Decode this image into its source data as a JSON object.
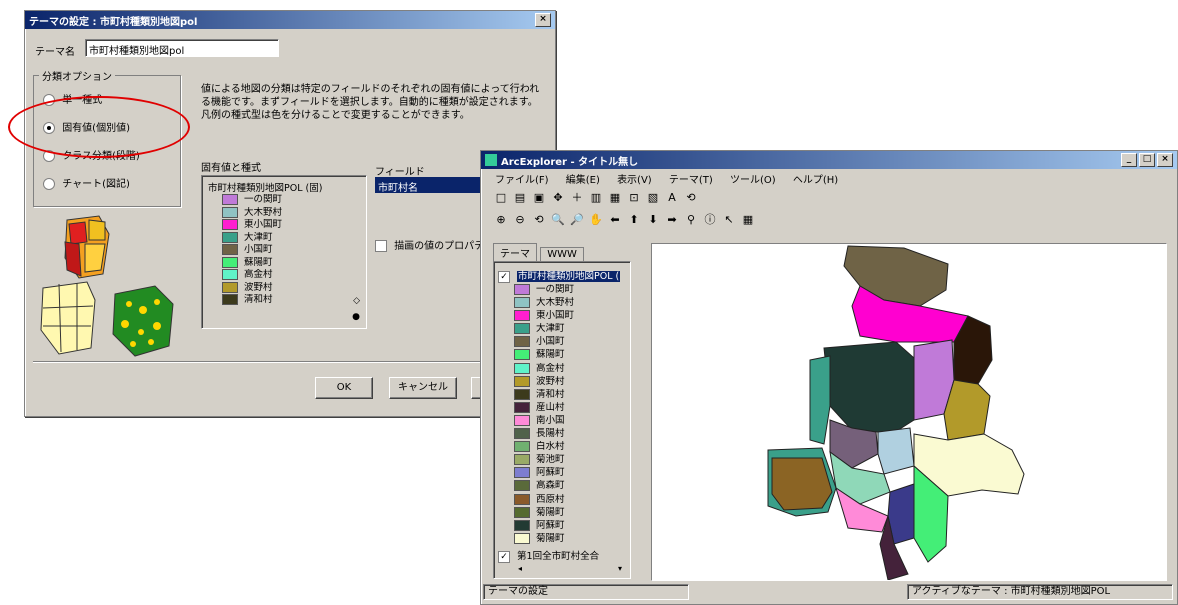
{
  "dialog": {
    "title": "テーマの設定 : 市町村種類別地図pol",
    "close": "×",
    "theme_name_label": "テーマ名",
    "theme_name_value": "市町村種類別地図pol",
    "group_title": "分類オプション",
    "options": [
      {
        "label": "単一種式",
        "selected": false
      },
      {
        "label": "固有値(個別値)",
        "selected": true
      },
      {
        "label": "クラス分類(段階)",
        "selected": false
      },
      {
        "label": "チャート(図記)",
        "selected": false
      }
    ],
    "description": "値による地図の分類は特定のフィールドのそれぞれの固有値によって行われる機能です。まずフィールドを選択します。自動的に種類が設定されます。凡例の種式型は色を分けることで変更することができます。",
    "values_title": "固有値と種式",
    "legend_header": "市町村種類別地図POL (固)",
    "legend_items": [
      {
        "label": "一の関町",
        "color": "#c07ad8"
      },
      {
        "label": "大木野村",
        "color": "#8fc3c3"
      },
      {
        "label": "東小国町",
        "color": "#ff1fcf"
      },
      {
        "label": "大津町",
        "color": "#3aa08a"
      },
      {
        "label": "小国町",
        "color": "#6f6346"
      },
      {
        "label": "蘇陽町",
        "color": "#44ee77"
      },
      {
        "label": "高金村",
        "color": "#5ff2c8"
      },
      {
        "label": "波野村",
        "color": "#b29a2a"
      },
      {
        "label": "清和村",
        "color": "#3c3a1c"
      }
    ],
    "field_label": "フィールド",
    "field_value": "市町村名",
    "checkbox_label": "描画の値のプロパティ",
    "ok": "OK",
    "cancel": "キャンセル"
  },
  "app": {
    "title": "ArcExplorer ‐ タイトル無し",
    "controls": [
      "_",
      "□",
      "×"
    ],
    "menu": [
      "ファイル(F)",
      "編集(E)",
      "表示(V)",
      "テーマ(T)",
      "ツール(O)",
      "ヘルプ(H)"
    ],
    "toolbar1": [
      "□",
      "▤",
      "▣",
      "✥",
      "＋",
      "▥",
      "▦",
      "⊡",
      "▧",
      "A",
      "⟲"
    ],
    "toolbar2": [
      "⊕",
      "⊖",
      "⟲",
      "🔍",
      "🔎",
      "✋",
      "⬅",
      "⬆",
      "⬇",
      "➡",
      "⚲",
      "ⓘ",
      "↖",
      "▦"
    ],
    "tabs": [
      "テーマ",
      "WWW"
    ],
    "legend_header": "市町村種類別地図POL (",
    "legend_items": [
      {
        "label": "一の関町",
        "color": "#c07ad8"
      },
      {
        "label": "大木野村",
        "color": "#8fc3c3"
      },
      {
        "label": "東小国町",
        "color": "#ff1fcf"
      },
      {
        "label": "大津町",
        "color": "#3aa08a"
      },
      {
        "label": "小国町",
        "color": "#6f6346"
      },
      {
        "label": "蘇陽町",
        "color": "#44ee77"
      },
      {
        "label": "高金村",
        "color": "#5ff2c8"
      },
      {
        "label": "波野村",
        "color": "#b29a2a"
      },
      {
        "label": "清和村",
        "color": "#3c3a1c"
      },
      {
        "label": "産山村",
        "color": "#44223a"
      },
      {
        "label": "南小国",
        "color": "#ff8ad8"
      },
      {
        "label": "長陽村",
        "color": "#50624a"
      },
      {
        "label": "白水村",
        "color": "#70b070"
      },
      {
        "label": "菊池町",
        "color": "#99aa66"
      },
      {
        "label": "阿蘇町",
        "color": "#7d7dcf"
      },
      {
        "label": "高森町",
        "color": "#5a6a3a"
      },
      {
        "label": "西原村",
        "color": "#8a5a2a"
      },
      {
        "label": "菊陽町",
        "color": "#556b2f"
      },
      {
        "label": "阿蘇町",
        "color": "#223a33"
      },
      {
        "label": "菊陽町",
        "color": "#fafad2"
      }
    ],
    "second_theme": "第1回全市町村全合",
    "status_left": "テーマの設定",
    "status_right": "アクティブなテーマ : 市町村種類別地図POL"
  }
}
